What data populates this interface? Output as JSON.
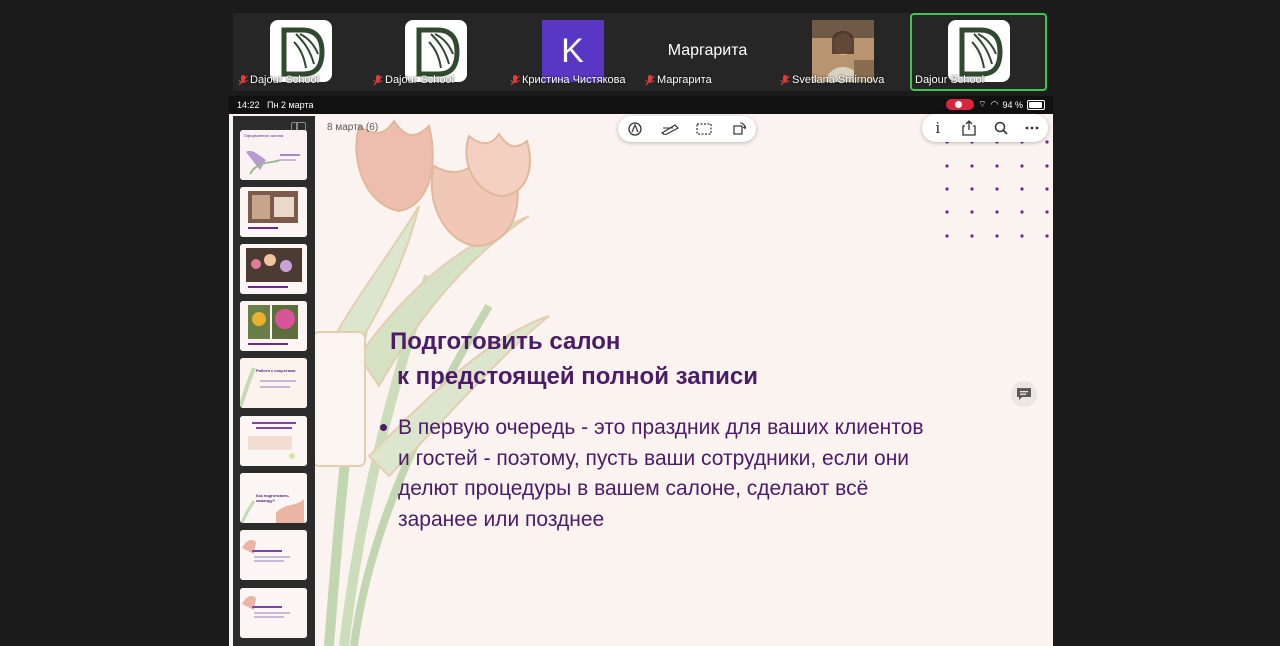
{
  "participants": [
    {
      "name": "Dajour School",
      "avatar": "logo",
      "muted": true,
      "active": false
    },
    {
      "name": "Dajour School",
      "avatar": "logo",
      "muted": true,
      "active": false
    },
    {
      "name": "Кристина Чистякова",
      "avatar": "K",
      "muted": true,
      "active": false
    },
    {
      "name": "Маргарита",
      "avatar": "name-only",
      "display_name": "Маргарита",
      "muted": true,
      "active": false
    },
    {
      "name": "Svetlana Smirnova",
      "avatar": "photo",
      "muted": true,
      "active": false
    },
    {
      "name": "Dajour School",
      "avatar": "logo",
      "muted": false,
      "active": true
    }
  ],
  "statusbar": {
    "time": "14:22",
    "date": "Пн 2 марта",
    "battery": "94 %"
  },
  "document": {
    "title": "8 марта (6)"
  },
  "slide": {
    "title_line1": "Подготовить салон",
    "title_line2": "к предстоящей полной записи",
    "bullet": "В первую очередь - это праздник для ваших клиентов и гостей - поэтому, пусть ваши сотрудники, если они делют процедуры в вашем салоне, сделают всё заранее или позднее"
  },
  "thumbnails": [
    {
      "caption": "Оформление салона"
    },
    {
      "caption": ""
    },
    {
      "caption": ""
    },
    {
      "caption": ""
    },
    {
      "caption": "Работа с соцсетями"
    },
    {
      "caption": ""
    },
    {
      "caption": "Как подготовить команду?"
    },
    {
      "caption": ""
    },
    {
      "caption": ""
    }
  ],
  "colors": {
    "accent": "#4b1b68",
    "active_border": "#3fc455",
    "avatar_k": "#5a36c4",
    "recording": "#d7263d"
  },
  "icons": {
    "center_toolbar": [
      "markup-pen-icon",
      "ruler-icon",
      "select-rect-icon",
      "rotate-icon"
    ],
    "right_toolbar": [
      "info-icon",
      "share-icon",
      "search-icon",
      "more-icon"
    ]
  }
}
